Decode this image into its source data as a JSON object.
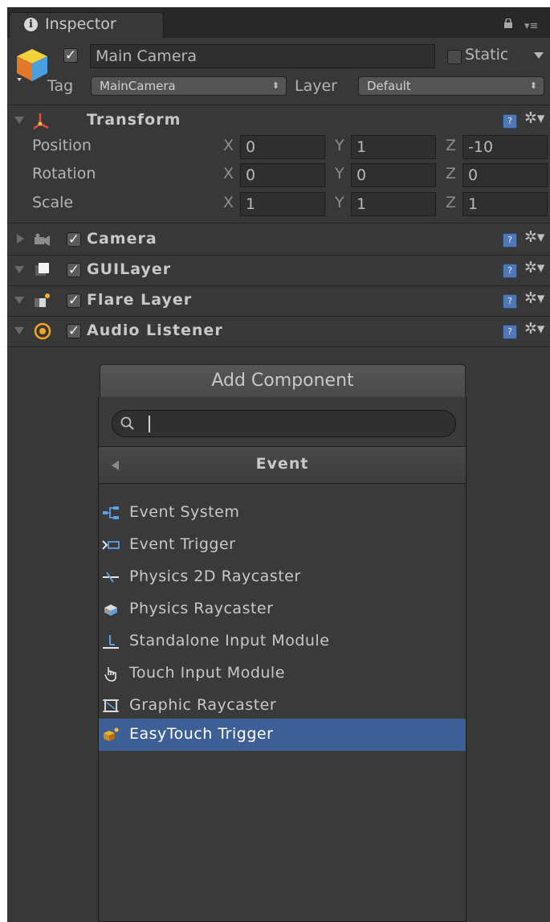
{
  "tab": {
    "title": "Inspector",
    "info_glyph": "i"
  },
  "object": {
    "active": true,
    "name": "Main Camera",
    "static_label": "Static",
    "static_checked": false,
    "tag_label": "Tag",
    "tag_value": "MainCamera",
    "layer_label": "Layer",
    "layer_value": "Default",
    "popup_arrows": "⬍"
  },
  "transform": {
    "title": "Transform",
    "rows": [
      {
        "label": "Position",
        "x": "0",
        "y": "1",
        "z": "-10"
      },
      {
        "label": "Rotation",
        "x": "0",
        "y": "0",
        "z": "0"
      },
      {
        "label": "Scale",
        "x": "1",
        "y": "1",
        "z": "1"
      }
    ],
    "axis_labels": {
      "x": "X",
      "y": "Y",
      "z": "Z"
    }
  },
  "components": [
    {
      "title": "Camera",
      "enabled": true,
      "expanded": false,
      "icon": "camera-icon"
    },
    {
      "title": "GUILayer",
      "enabled": true,
      "expanded": true,
      "icon": "guilayer-icon"
    },
    {
      "title": "Flare Layer",
      "enabled": true,
      "expanded": true,
      "icon": "flare-layer-icon"
    },
    {
      "title": "Audio Listener",
      "enabled": true,
      "expanded": true,
      "icon": "audio-listener-icon"
    }
  ],
  "glyphs": {
    "check": "✓",
    "help": "?",
    "gear": "✲▾",
    "tab_menu": "▾≡"
  },
  "add_component": {
    "button_label": "Add Component",
    "search_value": "",
    "category": "Event",
    "items": [
      {
        "label": "Event System",
        "icon": "event-system-icon",
        "selected": false
      },
      {
        "label": "Event Trigger",
        "icon": "event-trigger-icon",
        "selected": false
      },
      {
        "label": "Physics 2D Raycaster",
        "icon": "physics-2d-raycaster-icon",
        "selected": false
      },
      {
        "label": "Physics Raycaster",
        "icon": "physics-raycaster-icon",
        "selected": false
      },
      {
        "label": "Standalone Input Module",
        "icon": "standalone-input-module-icon",
        "selected": false
      },
      {
        "label": "Touch Input Module",
        "icon": "touch-input-module-icon",
        "selected": false
      },
      {
        "label": "Graphic Raycaster",
        "icon": "graphic-raycaster-icon",
        "selected": false
      },
      {
        "label": "EasyTouch Trigger",
        "icon": "easytouch-trigger-icon",
        "selected": true
      }
    ]
  },
  "colors": {
    "panel_bg": "#383838",
    "selection": "#3e5f96",
    "help_blue": "#4f78b5"
  }
}
